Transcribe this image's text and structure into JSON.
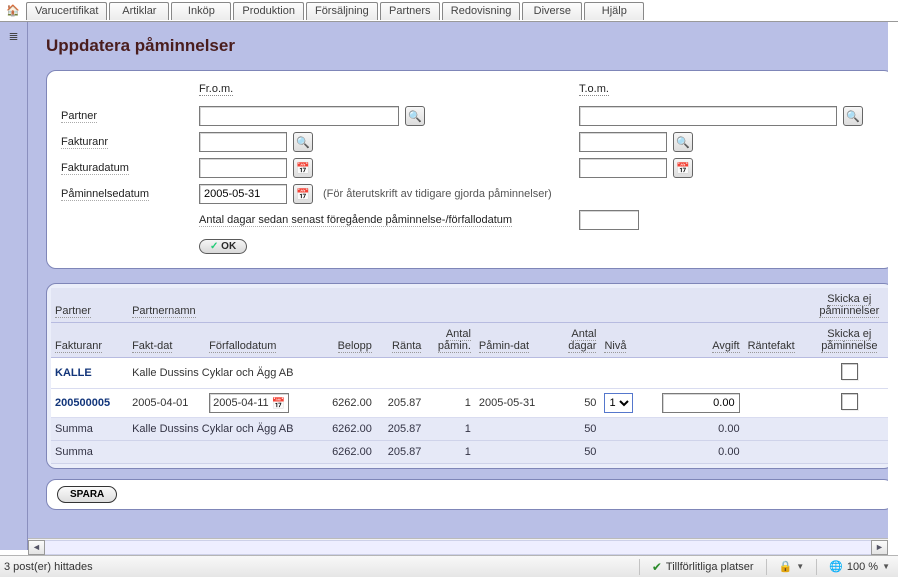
{
  "tabs": [
    "Varucertifikat",
    "Artiklar",
    "Inköp",
    "Produktion",
    "Försäljning",
    "Partners",
    "Redovisning",
    "Diverse",
    "Hjälp"
  ],
  "page": {
    "title": "Uppdatera påminnelser"
  },
  "filter": {
    "from_label": "Fr.o.m.",
    "to_label": "T.o.m.",
    "rows": {
      "partner": "Partner",
      "fakturanr": "Fakturanr",
      "fakturadatum": "Fakturadatum",
      "paminnelsedatum": "Påminnelsedatum"
    },
    "paminnelsedatum_value": "2005-05-31",
    "hint": "(För återutskrift av tidigare gjorda påminnelser)",
    "long_label": "Antal dagar sedan senast föregående påminnelse-/förfallodatum",
    "ok_label": "OK"
  },
  "results": {
    "headers": {
      "partner": "Partner",
      "partnernamn": "Partnernamn",
      "fakturanr": "Fakturanr",
      "fakt_dat": "Fakt-dat",
      "forfallo": "Förfallodatum",
      "belopp": "Belopp",
      "ranta": "Ränta",
      "antal_pamin": "Antal påmin.",
      "pamin_dat": "Påmin-dat",
      "antal_dagar": "Antal dagar",
      "niva": "Nivå",
      "avgift": "Avgift",
      "rantefakt": "Räntefakt",
      "skicka_ej_paminnelser": "Skicka ej påminnelser",
      "skicka_ej_paminnelse": "Skicka ej påminnelse"
    },
    "group": {
      "partner": "KALLE",
      "name": "Kalle Dussins Cyklar och Ägg AB"
    },
    "row": {
      "fakturanr": "200500005",
      "fakt_dat": "2005-04-01",
      "forfallo": "2005-04-11",
      "belopp": "6262.00",
      "ranta": "205.87",
      "antal_pamin": "1",
      "pamin_dat": "2005-05-31",
      "antal_dagar": "50",
      "niva": "1",
      "avgift": "0.00"
    },
    "sum1": {
      "label": "Summa",
      "name": "Kalle Dussins Cyklar och Ägg AB",
      "belopp": "6262.00",
      "ranta": "205.87",
      "antal_pamin": "1",
      "antal_dagar": "50",
      "avgift": "0.00"
    },
    "sum2": {
      "label": "Summa",
      "belopp": "6262.00",
      "ranta": "205.87",
      "antal_pamin": "1",
      "antal_dagar": "50",
      "avgift": "0.00"
    }
  },
  "save": {
    "label": "SPARA"
  },
  "status": {
    "left": "3 post(er) hittades",
    "trust": "Tillförlitliga platser",
    "zoom": "100 %"
  },
  "icons": {
    "search": "🔍",
    "calendar": "📅",
    "home": "🏠",
    "list": "≣",
    "globe": "🌐"
  }
}
